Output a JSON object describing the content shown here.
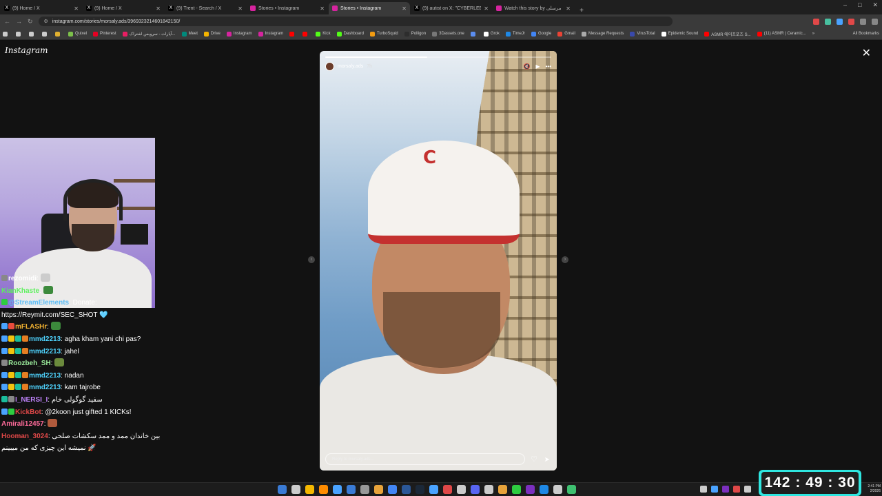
{
  "browser": {
    "tabs": [
      {
        "title": "(9) Home / X",
        "fav": "X",
        "color": "#000000"
      },
      {
        "title": "(9) Home / X",
        "fav": "X",
        "color": "#000000"
      },
      {
        "title": "(9) Trent - Search / X",
        "fav": "X",
        "color": "#000000"
      },
      {
        "title": "Stories • Instagram",
        "fav": "",
        "color": "#d6249f"
      },
      {
        "title": "Stories • Instagram",
        "fav": "",
        "color": "#d6249f"
      },
      {
        "title": "(9) autist on X: \"CYBERLEEK GT...",
        "fav": "X",
        "color": "#000000"
      },
      {
        "title": "Watch this story by رضا مرسلی",
        "fav": "",
        "color": "#d6249f"
      }
    ],
    "active_tab": 4,
    "new_tab": "+",
    "window_controls": [
      "–",
      "□",
      "✕"
    ],
    "url": "instagram.com/stories/morsaly.ads/3969323214601842150/",
    "bookmarks": [
      {
        "label": "",
        "color": "#cccccc"
      },
      {
        "label": "",
        "color": "#cccccc"
      },
      {
        "label": "",
        "color": "#cccccc"
      },
      {
        "label": "",
        "color": "#cccccc"
      },
      {
        "label": "",
        "color": "#e0b030"
      },
      {
        "label": "Quixel",
        "color": "#7cc04a"
      },
      {
        "label": "Pinterest",
        "color": "#e60023"
      },
      {
        "label": "آپارات - سرویس اشتراک...",
        "color": "#e91e63"
      },
      {
        "label": "Meet",
        "color": "#00897b"
      },
      {
        "label": "Drive",
        "color": "#f4b400"
      },
      {
        "label": "Instagram",
        "color": "#d6249f"
      },
      {
        "label": "Instagram",
        "color": "#d6249f"
      },
      {
        "label": "",
        "color": "#ff0000"
      },
      {
        "label": "",
        "color": "#ff0000"
      },
      {
        "label": "Kick",
        "color": "#53fc18"
      },
      {
        "label": "Dashboard",
        "color": "#53fc18"
      },
      {
        "label": "TurboSquid",
        "color": "#f39c12"
      },
      {
        "label": "Poliigon",
        "color": "#2d2d2d"
      },
      {
        "label": "3Dassets.one",
        "color": "#777777"
      },
      {
        "label": "",
        "color": "#5b8def"
      },
      {
        "label": "Grok",
        "color": "#ffffff"
      },
      {
        "label": "TimeJr",
        "color": "#1e88e5"
      },
      {
        "label": "Google",
        "color": "#4285f4"
      },
      {
        "label": "Gmail",
        "color": "#ea4335"
      },
      {
        "label": "Message Requests",
        "color": "#aaaaaa"
      },
      {
        "label": "VirusTotal",
        "color": "#3949ab"
      },
      {
        "label": "Epidemic Sound",
        "color": "#ffffff"
      },
      {
        "label": "ASMR 에이프포즈 S...",
        "color": "#ff0000"
      },
      {
        "label": "(11) ASMR | Ceramic...",
        "color": "#ff0000"
      }
    ],
    "more_bookmarks": "»",
    "all_bookmarks": "All Bookmarks"
  },
  "instagram": {
    "logo": "Instagram",
    "close": "✕",
    "story": {
      "username": "morsaly.ads",
      "time": "7h",
      "progress": 0.45,
      "reply_placeholder": "Reply to morsaly.ads...",
      "cap_logo": "C",
      "controls": [
        "🔇",
        "▶",
        "•••"
      ],
      "like": "♡",
      "send": "➤"
    },
    "prev": "‹",
    "next": "›"
  },
  "chat": [
    {
      "badges": [
        "#888888"
      ],
      "user": "rezomidi",
      "user_color": "#ffffff",
      "text": "",
      "emote": "#cccccc"
    },
    {
      "badges": [],
      "user": "KianKhaste",
      "user_color": "#5df05d",
      "text": "",
      "emote": "#3c8a3c"
    },
    {
      "badges": [
        "#2ecc40"
      ],
      "user": "@StreamElements",
      "user_color": "#5bbcf5",
      "text": ": Donate:",
      "emote": ""
    },
    {
      "badges": [],
      "user": "",
      "user_color": "#ffffff",
      "text": "https://Reymit.com/SEC_SHOT 🩵",
      "emote": ""
    },
    {
      "badges": [
        "#4aa3ff",
        "#e74c3c"
      ],
      "user": "mFLASHr",
      "user_color": "#f0b030",
      "text": "",
      "emote": "#3c8a3c"
    },
    {
      "badges": [
        "#4aa3ff",
        "#f1c40f",
        "#1abc9c",
        "#e67e22"
      ],
      "user": "mmd2213",
      "user_color": "#4fd4ff",
      "text": ": agha kham yani chi pas?",
      "emote": ""
    },
    {
      "badges": [
        "#4aa3ff",
        "#f1c40f",
        "#1abc9c",
        "#e67e22"
      ],
      "user": "mmd2213",
      "user_color": "#4fd4ff",
      "text": ": jahel",
      "emote": ""
    },
    {
      "badges": [
        "#888888"
      ],
      "user": "Roozbeh_SH",
      "user_color": "#9ef09e",
      "text": "",
      "emote": "#6b8a3c"
    },
    {
      "badges": [
        "#4aa3ff",
        "#f1c40f",
        "#1abc9c",
        "#e67e22"
      ],
      "user": "mmd2213",
      "user_color": "#4fd4ff",
      "text": ": nadan",
      "emote": ""
    },
    {
      "badges": [
        "#4aa3ff",
        "#f1c40f",
        "#1abc9c",
        "#e67e22"
      ],
      "user": "mmd2213",
      "user_color": "#4fd4ff",
      "text": ": kam tajrobe",
      "emote": ""
    },
    {
      "badges": [
        "#1abc9c",
        "#888888"
      ],
      "user": "I_NERSI_I",
      "user_color": "#c084fc",
      "text": ": سفید گوگولی خام",
      "emote": ""
    },
    {
      "badges": [
        "#4aa3ff",
        "#2ecc40"
      ],
      "user": "KickBot",
      "user_color": "#e04848",
      "text": ": @2koon just gifted 1 KICKs!",
      "emote": ""
    },
    {
      "badges": [],
      "user": "Amirali12457",
      "user_color": "#ff6b9a",
      "text": "",
      "emote": "#b05a3c"
    },
    {
      "badges": [],
      "user": "Hooman_3024",
      "user_color": "#e04848",
      "text": ": بین خاندان ممد و ممد سکشات صلحی",
      "emote": ""
    },
    {
      "badges": [],
      "user": "",
      "user_color": "#ffffff",
      "text": "نمیشه این چیزی که من میبینم 🚀",
      "emote": ""
    }
  ],
  "taskbar": {
    "apps": [
      "#3a7bd5",
      "#cccccc",
      "#f5b800",
      "#ff8c00",
      "#4aa3ff",
      "#3a7bd5",
      "#999999",
      "#e8a33a",
      "#4285f4",
      "#2b5797",
      "#1b2838",
      "#4aa3ff",
      "#e04848",
      "#cccccc",
      "#5865f2",
      "#cccccc",
      "#e8a33a",
      "#2ecc40",
      "#7b2fbe",
      "#1e88e5",
      "#cccccc",
      "#3ec070"
    ],
    "tray": [
      "#cccccc",
      "#4aa3ff",
      "#7b2fbe",
      "#e04848",
      "#cccccc"
    ],
    "time": "2:41 PM",
    "date": "2/2026"
  },
  "timer": "142 : 49 : 30"
}
